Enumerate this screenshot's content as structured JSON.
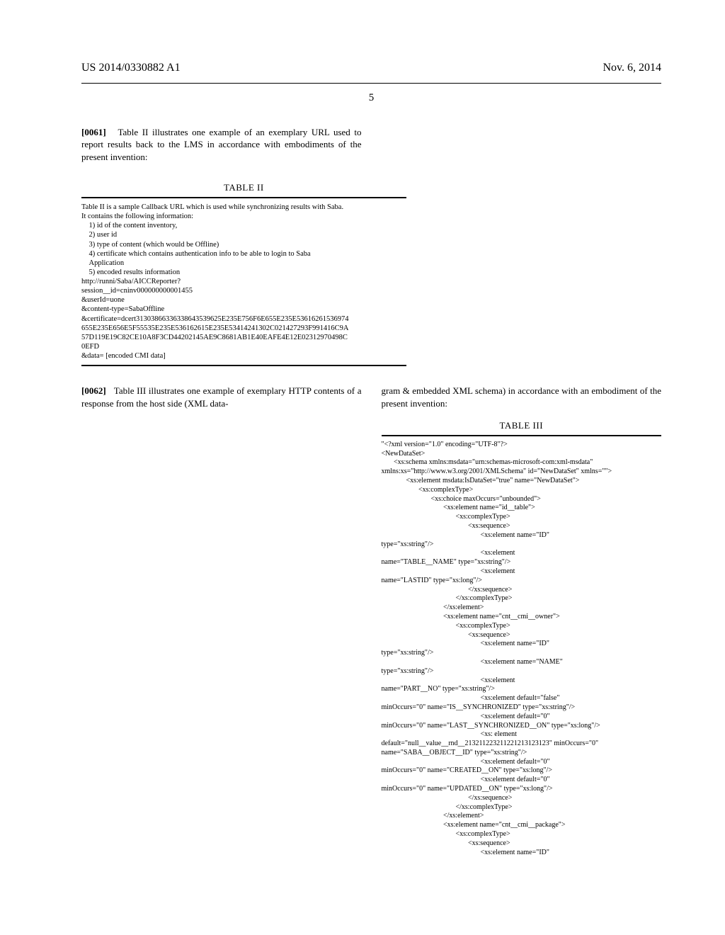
{
  "header": {
    "pubNum": "US 2014/0330882 A1",
    "date": "Nov. 6, 2014",
    "pageNum": "5"
  },
  "paragraphs": {
    "p61_num": "[0061]",
    "p61_text": "Table II illustrates one example of an exemplary URL used to report results back to the LMS in accordance with embodiments of the present invention:",
    "p62_num": "[0062]",
    "p62_text": "Table III illustrates one example of exemplary HTTP contents of a response from the host side (XML data-",
    "p62_cont": "gram & embedded XML schema) in accordance with an embodiment of the present invention:"
  },
  "table2": {
    "title": "TABLE II",
    "body": "Table II is a sample Callback URL which is used while synchronizing results with Saba.\nIt contains the following information:\n    1) id of the content inventory,\n    2) user id\n    3) type of content (which would be Offline)\n    4) certificate which contains authentication info to be able to login to Saba\n    Application\n    5) encoded results information\nhttp://runni/Saba/AICCReporter?\nsession__id=cninv000000000001455\n&userId=uone\n&content-type=SabaOffline\n&certificate=dcert31303866336338643539625E235E756F6E655E235E53616261536974\n655E235E656E5F55535E235E536162615E235E53414241302C021427293F991416C9A\n57D119E19C82CE10A8F3CD44202145AE9C8681AB1E40EAFE4E12E02312970498C\n0EFD\n&data= [encoded CMI data]"
  },
  "table3": {
    "title": "TABLE III",
    "body": "\"<?xml version=\"1.0\" encoding=\"UTF-8\"?>\n<NewDataSet>\n       <xs:schema xmlns:msdata=\"urn:schemas-microsoft-com:xml-msdata\"\nxmlns:xs=\"http://www.w3.org/2001/XMLSchema\" id=\"NewDataSet\" xmlns=\"\">\n              <xs:element msdata:IsDataSet=\"true\" name=\"NewDataSet\">\n                     <xs:complexType>\n                            <xs:choice maxOccurs=\"unbounded\">\n                                   <xs:element name=\"id__table\">\n                                          <xs:complexType>\n                                                 <xs:sequence>\n                                                        <xs:element name=\"ID\"\ntype=\"xs:string\"/>\n                                                        <xs:element\nname=\"TABLE__NAME\" type=\"xs:string\"/>\n                                                        <xs:element\nname=\"LASTID\" type=\"xs:long\"/>\n                                                 </xs:sequence>\n                                          </xs:complexType>\n                                   </xs:element>\n                                   <xs:element name=\"cnt__cmi__owner\">\n                                          <xs:complexType>\n                                                 <xs:sequence>\n                                                        <xs:element name=\"ID\"\ntype=\"xs:string\"/>\n                                                        <xs:element name=\"NAME\"\ntype=\"xs:string\"/>\n                                                        <xs:element\nname=\"PART__NO\" type=\"xs:string\"/>\n                                                        <xs:element default=\"false\"\nminOccurs=\"0\" name=\"IS__SYNCHRONIZED\" type=\"xs:string\"/>\n                                                        <xs:element default=\"0\"\nminOccurs=\"0\" name=\"LAST__SYNCHRONIZED__ON\" type=\"xs:long\"/>\n                                                        <xs: element\ndefault=\"null__value__rnd__213211223211221213123123\" minOccurs=\"0\"\nname=\"SABA__OBJECT__ID\" type=\"xs:string\"/>\n                                                        <xs:element default=\"0\"\nminOccurs=\"0\" name=\"CREATED__ON\" type=\"xs:long\"/>\n                                                        <xs:element default=\"0\"\nminOccurs=\"0\" name=\"UPDATED__ON\" type=\"xs:long\"/>\n                                                 </xs:sequence>\n                                          </xs:complexType>\n                                   </xs:element>\n                                   <xs:element name=\"cnt__cmi__package\">\n                                          <xs:complexType>\n                                                 <xs:sequence>\n                                                        <xs:element name=\"ID\""
  }
}
